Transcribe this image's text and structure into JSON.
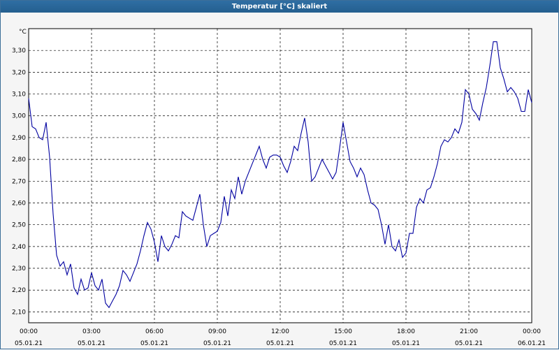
{
  "window": {
    "title": "Temperatur [°C] skaliert"
  },
  "chart_data": {
    "type": "line",
    "title": "Temperatur [°C] skaliert",
    "ylabel": "°C",
    "xlabel": "",
    "xlim": [
      "05.01.21 00:00",
      "06.01.21 00:00"
    ],
    "ylim": [
      2.05,
      3.4
    ],
    "grid": true,
    "line_color": "#0000a0",
    "y_ticks": [
      "2,10",
      "2,20",
      "2,30",
      "2,40",
      "2,50",
      "2,60",
      "2,70",
      "2,80",
      "2,90",
      "3,00",
      "3,10",
      "3,20",
      "3,30"
    ],
    "x_ticks": [
      {
        "time": "00:00",
        "date": "05.01.21"
      },
      {
        "time": "03:00",
        "date": "05.01.21"
      },
      {
        "time": "06:00",
        "date": "05.01.21"
      },
      {
        "time": "09:00",
        "date": "05.01.21"
      },
      {
        "time": "12:00",
        "date": "05.01.21"
      },
      {
        "time": "15:00",
        "date": "05.01.21"
      },
      {
        "time": "18:00",
        "date": "05.01.21"
      },
      {
        "time": "21:00",
        "date": "05.01.21"
      },
      {
        "time": "00:00",
        "date": "06.01.21"
      }
    ],
    "series": [
      {
        "x": [
          "00:00",
          "00:10",
          "00:20",
          "00:30",
          "00:40",
          "00:50",
          "01:00",
          "01:10",
          "01:20",
          "01:30",
          "01:40",
          "01:50",
          "02:00",
          "02:10",
          "02:20",
          "02:30",
          "02:40",
          "02:50",
          "03:00",
          "03:10",
          "03:20",
          "03:30",
          "03:40",
          "03:50",
          "04:00",
          "04:10",
          "04:20",
          "04:30",
          "04:40",
          "04:50",
          "05:00",
          "05:10",
          "05:20",
          "05:30",
          "05:40",
          "05:50",
          "06:00",
          "06:10",
          "06:20",
          "06:30",
          "06:40",
          "06:50",
          "07:00",
          "07:10",
          "07:20",
          "07:30",
          "07:40",
          "07:50",
          "08:00",
          "08:10",
          "08:20",
          "08:30",
          "08:40",
          "08:50",
          "09:00",
          "09:10",
          "09:20",
          "09:30",
          "09:40",
          "09:50",
          "10:00",
          "10:10",
          "10:20",
          "10:30",
          "10:40",
          "10:50",
          "11:00",
          "11:10",
          "11:20",
          "11:30",
          "11:40",
          "11:50",
          "12:00",
          "12:10",
          "12:20",
          "12:30",
          "12:40",
          "12:50",
          "13:00",
          "13:10",
          "13:20",
          "13:30",
          "13:40",
          "13:50",
          "14:00",
          "14:10",
          "14:20",
          "14:30",
          "14:40",
          "14:50",
          "15:00",
          "15:10",
          "15:20",
          "15:30",
          "15:40",
          "15:50",
          "16:00",
          "16:10",
          "16:20",
          "16:30",
          "16:40",
          "16:50",
          "17:00",
          "17:10",
          "17:20",
          "17:30",
          "17:40",
          "17:50",
          "18:00",
          "18:10",
          "18:20",
          "18:30",
          "18:40",
          "18:50",
          "19:00",
          "19:10",
          "19:20",
          "19:30",
          "19:40",
          "19:50",
          "20:00",
          "20:10",
          "20:20",
          "20:30",
          "20:40",
          "20:50",
          "21:00",
          "21:10",
          "21:20",
          "21:30",
          "21:40",
          "21:50",
          "22:00",
          "22:10",
          "22:20",
          "22:30",
          "22:40",
          "22:50",
          "23:00",
          "23:10",
          "23:20",
          "23:30",
          "23:40",
          "23:50",
          "24:00"
        ],
        "y": [
          3.08,
          2.95,
          2.94,
          2.9,
          2.89,
          2.97,
          2.81,
          2.55,
          2.36,
          2.31,
          2.33,
          2.27,
          2.32,
          2.21,
          2.18,
          2.25,
          2.2,
          2.21,
          2.28,
          2.22,
          2.2,
          2.25,
          2.14,
          2.12,
          2.15,
          2.18,
          2.22,
          2.29,
          2.27,
          2.24,
          2.28,
          2.32,
          2.38,
          2.45,
          2.51,
          2.48,
          2.42,
          2.33,
          2.45,
          2.4,
          2.38,
          2.41,
          2.45,
          2.44,
          2.56,
          2.54,
          2.53,
          2.52,
          2.58,
          2.64,
          2.5,
          2.4,
          2.45,
          2.46,
          2.47,
          2.51,
          2.63,
          2.54,
          2.66,
          2.62,
          2.72,
          2.64,
          2.7,
          2.74,
          2.78,
          2.82,
          2.86,
          2.8,
          2.76,
          2.81,
          2.82,
          2.82,
          2.81,
          2.77,
          2.74,
          2.79,
          2.86,
          2.84,
          2.92,
          2.99,
          2.88,
          2.7,
          2.72,
          2.76,
          2.8,
          2.77,
          2.74,
          2.71,
          2.74,
          2.85,
          2.97,
          2.88,
          2.79,
          2.76,
          2.72,
          2.76,
          2.73,
          2.66,
          2.6,
          2.59,
          2.57,
          2.5,
          2.41,
          2.5,
          2.4,
          2.38,
          2.43,
          2.35,
          2.37,
          2.46,
          2.46,
          2.58,
          2.62,
          2.6,
          2.66,
          2.67,
          2.72,
          2.78,
          2.86,
          2.89,
          2.88,
          2.9,
          2.94,
          2.92,
          2.97,
          3.12,
          3.1,
          3.03,
          3.01,
          2.98,
          3.06,
          3.13,
          3.23,
          3.34,
          3.34,
          3.22,
          3.17,
          3.11,
          3.13,
          3.11,
          3.08,
          3.02,
          3.02,
          3.12,
          3.06
        ]
      }
    ]
  }
}
